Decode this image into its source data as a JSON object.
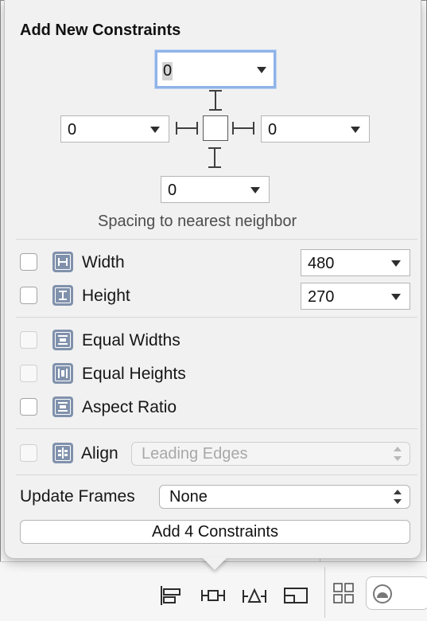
{
  "popover": {
    "title": "Add New Constraints",
    "spacing": {
      "top": "0",
      "left": "0",
      "right": "0",
      "bottom": "0",
      "caption": "Spacing to nearest neighbor"
    },
    "size": {
      "width_label": "Width",
      "width_value": "480",
      "height_label": "Height",
      "height_value": "270"
    },
    "equal": {
      "equal_widths": "Equal Widths",
      "equal_heights": "Equal Heights",
      "aspect_ratio": "Aspect Ratio"
    },
    "align": {
      "label": "Align",
      "value": "Leading Edges"
    },
    "update_frames": {
      "label": "Update Frames",
      "value": "None"
    },
    "add_button": "Add 4 Constraints"
  },
  "toolbar": {
    "icons": [
      "align-icon",
      "pin-icon",
      "resolve-issues-icon",
      "resizing-behavior-icon",
      "grid-icon",
      "size-class-icon"
    ]
  },
  "colors": {
    "focus_ring": "#8fb3e8",
    "icon_badge": "#8091ac",
    "popover_bg": "#f1f1f1"
  }
}
